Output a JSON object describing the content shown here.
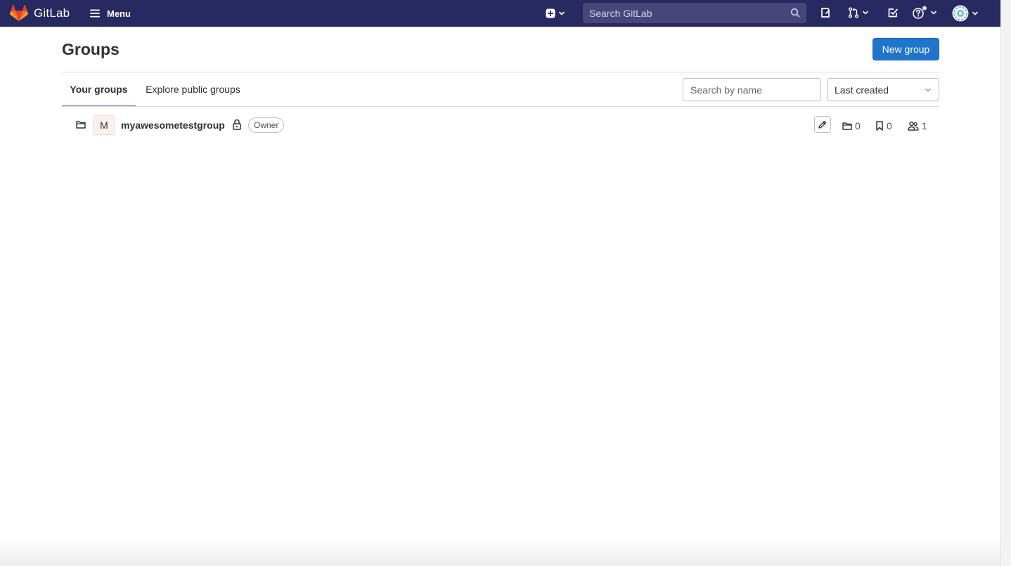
{
  "navbar": {
    "brand": "GitLab",
    "menu_label": "Menu",
    "search_placeholder": "Search GitLab",
    "colors": {
      "background": "#292961",
      "search_bg": "#46467a",
      "logo": "#fc6d26"
    },
    "icons": [
      "gitlab-logo-icon",
      "hamburger-icon",
      "plus-square-icon",
      "chevron-down-icon",
      "search-icon",
      "issues-icon",
      "merge-request-icon",
      "todo-icon",
      "help-icon",
      "user-avatar-icon"
    ]
  },
  "page": {
    "title": "Groups",
    "new_group_label": "New group",
    "accent_color": "#1f75cb"
  },
  "tabs": [
    {
      "label": "Your groups",
      "active": true
    },
    {
      "label": "Explore public groups",
      "active": false
    }
  ],
  "filter": {
    "search_placeholder": "Search by name",
    "sort_value": "Last created"
  },
  "groups": [
    {
      "avatar_letter": "M",
      "name": "myawesometestgroup",
      "visibility": "private",
      "role": "Owner",
      "subgroups": "0",
      "projects": "0",
      "members": "1"
    }
  ]
}
